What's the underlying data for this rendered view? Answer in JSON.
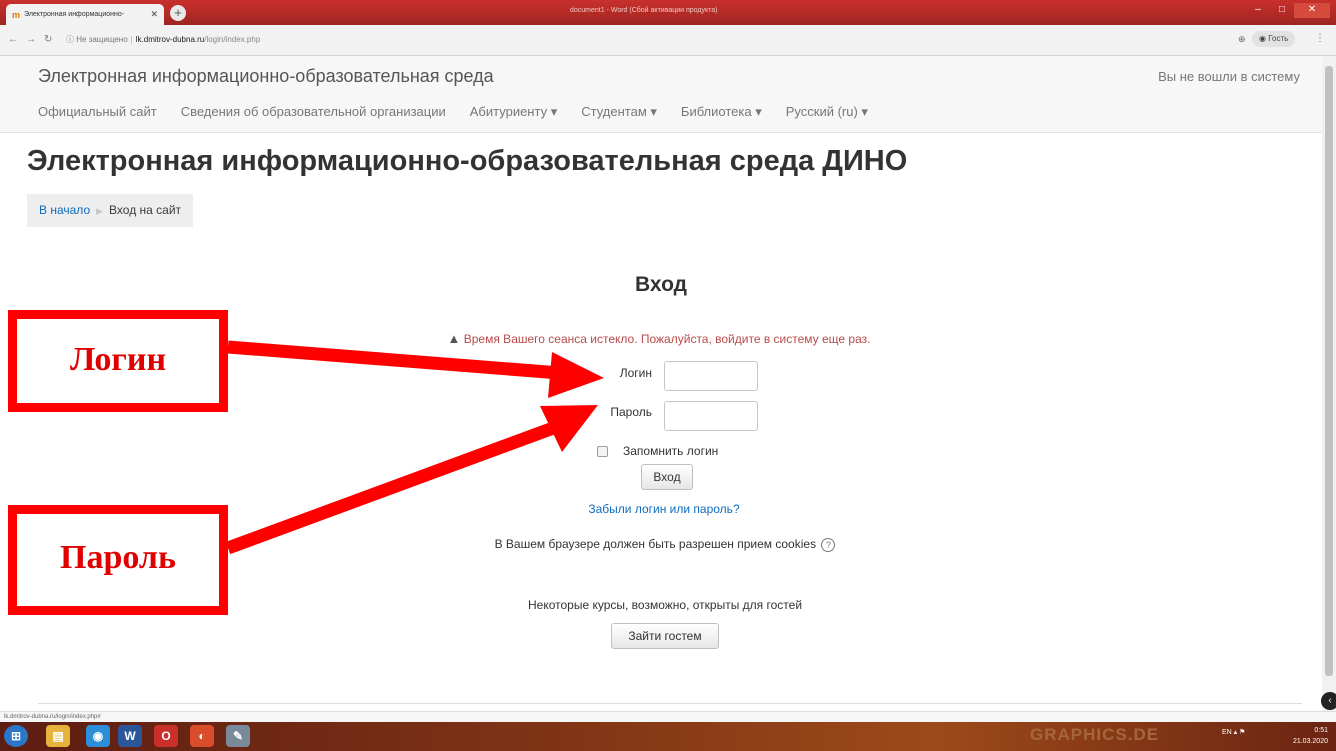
{
  "browser": {
    "tab_title": "Электронная информационно-",
    "window_title": "document1 - Word (Сбой активации продукта)",
    "url_security": "Не защищено",
    "url_host": "lk.dmitrov-dubna.ru",
    "url_path": "/login/index.php",
    "guest_label": "Гость",
    "status_url": "lk.dmitrov-dubna.ru/login/index.php#"
  },
  "navbar": {
    "brand": "Электронная информационно-образовательная среда",
    "user_status": "Вы не вошли в систему",
    "menu": [
      "Официальный сайт",
      "Сведения об образовательной организации",
      "Абитуриенту ▾",
      "Студентам ▾",
      "Библиотека ▾",
      "Русский (ru) ▾"
    ]
  },
  "page": {
    "title": "Электронная информационно-образовательная среда ДИНО",
    "breadcrumb": {
      "home": "В начало",
      "current": "Вход на сайт"
    }
  },
  "login": {
    "heading": "Вход",
    "error": "Время Вашего сеанса истекло. Пожалуйста, войдите в систему еще раз.",
    "username_label": "Логин",
    "password_label": "Пароль",
    "remember_label": "Запомнить логин",
    "submit_label": "Вход",
    "forgot_link": "Забыли логин или пароль?",
    "cookies_note": "В Вашем браузере должен быть разрешен прием cookies",
    "guest_note": "Некоторые курсы, возможно, открыты для гостей",
    "guest_button": "Зайти гостем"
  },
  "annotations": {
    "login_callout": "Логин",
    "password_callout": "Пароль",
    "color": "#ff0000"
  },
  "taskbar": {
    "watermark": "GRAPHICS.DE",
    "lang": "EN",
    "time": "0:51",
    "date": "21.03.2020"
  }
}
